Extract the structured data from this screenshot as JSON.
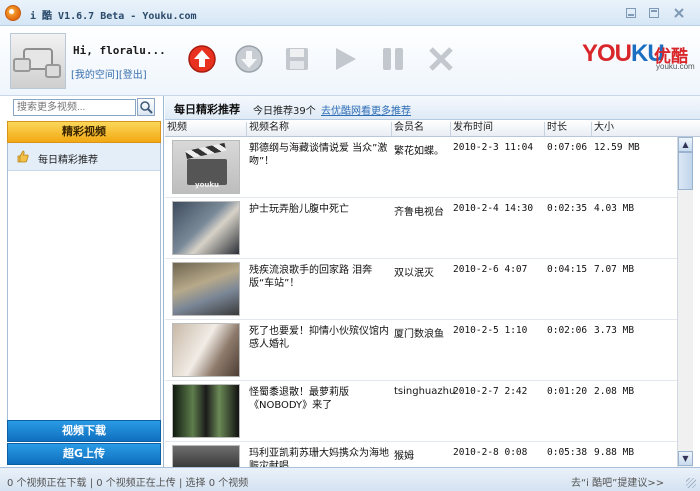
{
  "window": {
    "title": "i 酷 V1.6.7 Beta - Youku.com",
    "minimize_icon": "minimize-icon",
    "maximize_icon": "maximize-icon",
    "close_icon": "close-icon"
  },
  "header": {
    "greeting": "Hi, floralu...",
    "my_space_link": "[我的空间]",
    "logout_link": "[登出]",
    "toolbar": [
      "upload-icon",
      "download-icon",
      "save-icon",
      "play-icon",
      "pause-icon",
      "delete-icon"
    ],
    "logo": {
      "latin_red": "YOU",
      "latin_blue": "KU",
      "chinese": "优酷",
      "domain": "youku.com"
    }
  },
  "sidebar": {
    "search_placeholder": "搜索更多视频...",
    "active_category": "精彩视频",
    "items": [
      {
        "label": "每日精彩推荐",
        "icon": "thumbs-up-icon"
      }
    ],
    "tabs": {
      "download": "视频下载",
      "upload": "超G上传"
    }
  },
  "main": {
    "title": "每日精彩推荐",
    "count_text": "今日推荐39个",
    "more_link": "去优酷网看更多推荐",
    "columns": [
      "视频",
      "视频名称",
      "会员名",
      "发布时间",
      "时长",
      "大小"
    ],
    "rows": [
      {
        "name": "郭德纲与海藏谈情说爱 当众”激吻”！",
        "user": "繁花如蝶。",
        "time": "2010-2-3 11:04",
        "duration": "0:07:06",
        "size": "12.59 MB"
      },
      {
        "name": "护士玩弄胎儿腹中死亡",
        "user": "齐鲁电视台",
        "time": "2010-2-4 14:30",
        "duration": "0:02:35",
        "size": "4.03 MB"
      },
      {
        "name": "残疾流浪歌手的回家路 泪奔版“车站”！",
        "user": "双以泯灭",
        "time": "2010-2-6 4:07",
        "duration": "0:04:15",
        "size": "7.07 MB"
      },
      {
        "name": "死了也要爱！抑情小伙殡仪馆内感人婚礼",
        "user": "厦门数浪鱼",
        "time": "2010-2-5 1:10",
        "duration": "0:02:06",
        "size": "3.73 MB"
      },
      {
        "name": "怪蜀黍退散！最萝莉版《NOBODY》来了",
        "user": "tsinghuazhu",
        "time": "2010-2-7 2:42",
        "duration": "0:01:20",
        "size": "2.08 MB"
      },
      {
        "name": "玛利亚凯莉苏珊大妈携众为海地赈灾献唱",
        "user": "猴姆",
        "time": "2010-2-8 0:08",
        "duration": "0:05:38",
        "size": "9.88 MB"
      }
    ]
  },
  "status": {
    "left": "0 个视频正在下载 | 0 个视频正在上传 | 选择 0 个视频",
    "right": "去“i 酷吧”提建议>>"
  },
  "colors": {
    "accent_orange": "#f2a812",
    "tab_blue": "#0f6fbe",
    "brand_red": "#d9262a",
    "brand_blue": "#1b6fc1"
  }
}
